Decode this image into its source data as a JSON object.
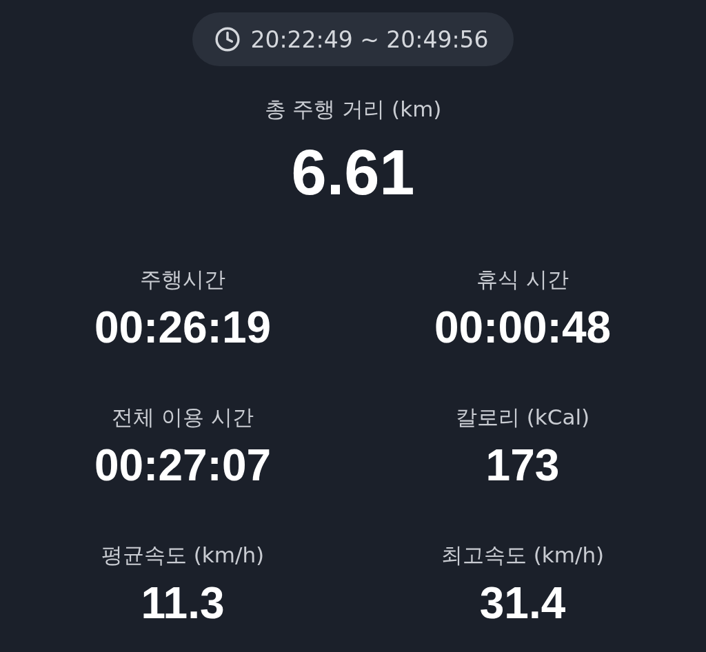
{
  "time_range": "20:22:49 ~ 20:49:56",
  "total_distance": {
    "label": "총 주행 거리 (km)",
    "value": "6.61"
  },
  "stats": [
    {
      "label": "주행시간",
      "value": "00:26:19"
    },
    {
      "label": "휴식 시간",
      "value": "00:00:48"
    },
    {
      "label": "전체 이용 시간",
      "value": "00:27:07"
    },
    {
      "label": "칼로리 (kCal)",
      "value": "173"
    },
    {
      "label": "평균속도 (km/h)",
      "value": "11.3"
    },
    {
      "label": "최고속도 (km/h)",
      "value": "31.4"
    }
  ]
}
